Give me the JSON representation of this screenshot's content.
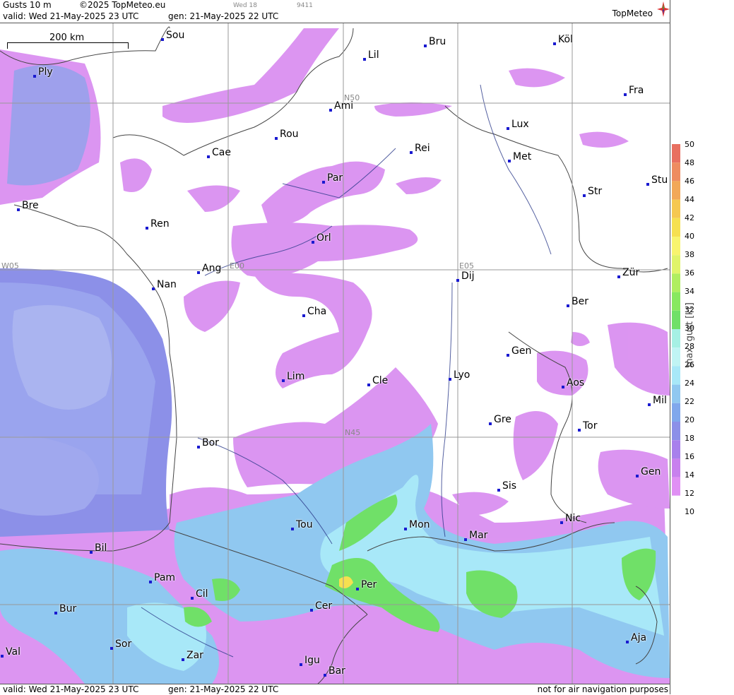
{
  "header": {
    "product": "Gusts 10 m",
    "copyright": "©2025 TopMeteo.eu",
    "day_label": "Wed 18",
    "code": "9411",
    "valid": "valid:  Wed  21-May-2025  23 UTC",
    "gen": "gen:  21-May-2025  22 UTC",
    "logo": "TopMeteo"
  },
  "footer": {
    "valid": "valid:  Wed  21-May-2025  23 UTC",
    "gen": "gen:  21-May-2025  22 UTC",
    "note": "not for air navigation purposes"
  },
  "scale": {
    "label": "200 km"
  },
  "grid_labels": {
    "n50": "N50",
    "n45": "N45",
    "w05": "W05",
    "e00": "E00",
    "e05": "E05"
  },
  "cities": [
    "Sou",
    "Bru",
    "Köl",
    "Lil",
    "Ply",
    "Ami",
    "Fra",
    "Rou",
    "Lux",
    "Cae",
    "Rei",
    "Met",
    "Par",
    "Stu",
    "Str",
    "Bre",
    "Ren",
    "Orl",
    "Ang",
    "Dij",
    "Zür",
    "Nan",
    "Cha",
    "Ber",
    "Gen",
    "Lim",
    "Cle",
    "Lyo",
    "Aos",
    "Mil",
    "Gre",
    "Tor",
    "Bor",
    "Gen",
    "Sis",
    "Nic",
    "Tou",
    "Mon",
    "Mar",
    "Bil",
    "Pam",
    "Cil",
    "Per",
    "Bur",
    "Cer",
    "Aja",
    "Val",
    "Sor",
    "Zar",
    "Igu",
    "Bar"
  ],
  "legend": {
    "title": "max. gust [kt]",
    "ticks": [
      "50",
      "48",
      "46",
      "44",
      "42",
      "40",
      "38",
      "36",
      "34",
      "32",
      "30",
      "28",
      "26",
      "24",
      "22",
      "20",
      "18",
      "16",
      "14",
      "12",
      "10"
    ],
    "colors": [
      "#e87060",
      "#ee8c60",
      "#f2a858",
      "#f6c850",
      "#f6e050",
      "#f8f46e",
      "#e0f46a",
      "#b0ee60",
      "#88e860",
      "#70e068",
      "#a6f0e4",
      "#c0f4f4",
      "#a8e8f8",
      "#90c8f0",
      "#80a8ec",
      "#8c90e8",
      "#a880ec",
      "#c880ee",
      "#e090f4",
      "#ffffff"
    ]
  }
}
